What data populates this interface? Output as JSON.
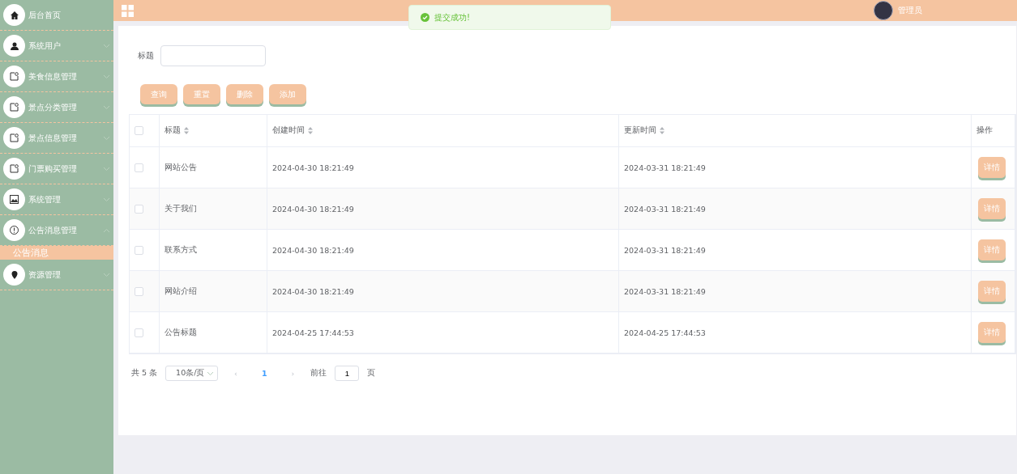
{
  "sidebar": {
    "items": [
      {
        "label": "后台首页"
      },
      {
        "label": "系统用户",
        "expanded": false
      },
      {
        "label": "美食信息管理",
        "expanded": false
      },
      {
        "label": "景点分类管理",
        "expanded": false
      },
      {
        "label": "景点信息管理",
        "expanded": false
      },
      {
        "label": "门票购买管理",
        "expanded": false
      },
      {
        "label": "系统管理",
        "expanded": false
      },
      {
        "label": "公告消息管理",
        "expanded": true,
        "children": [
          {
            "label": "公告消息",
            "selected": true
          }
        ]
      },
      {
        "label": "资源管理",
        "expanded": false
      }
    ]
  },
  "header": {
    "user": "管理员"
  },
  "toast": {
    "message": "提交成功!"
  },
  "search": {
    "label": "标题"
  },
  "buttons": [
    "查询",
    "重置",
    "删除",
    "添加"
  ],
  "table": {
    "all_checked": false,
    "columns": [
      {
        "label": "标题"
      },
      {
        "label": "创建时间"
      },
      {
        "label": "更新时间"
      },
      {
        "label": "操作"
      }
    ],
    "rows": [
      {
        "checked": false,
        "title": "网站公告",
        "created": "2024-04-30 18:21:49",
        "updated": "2024-03-31 18:21:49",
        "action": "详情"
      },
      {
        "checked": false,
        "title": "关于我们",
        "created": "2024-04-30 18:21:49",
        "updated": "2024-03-31 18:21:49",
        "action": "详情"
      },
      {
        "checked": false,
        "title": "联系方式",
        "created": "2024-04-30 18:21:49",
        "updated": "2024-03-31 18:21:49",
        "action": "详情"
      },
      {
        "checked": false,
        "title": "网站介绍",
        "created": "2024-04-30 18:21:49",
        "updated": "2024-03-31 18:21:49",
        "action": "详情"
      },
      {
        "checked": false,
        "title": "公告标题",
        "created": "2024-04-25 17:44:53",
        "updated": "2024-04-25 17:44:53",
        "action": "详情"
      }
    ]
  },
  "pagination": {
    "total": "共 5 条",
    "page_size": "10条/页",
    "prev": "‹",
    "pages": [
      {
        "label": "1",
        "selected": true
      }
    ],
    "next": "›",
    "goto_label": "前往",
    "goto_value": "1",
    "goto_suffix": "页"
  }
}
